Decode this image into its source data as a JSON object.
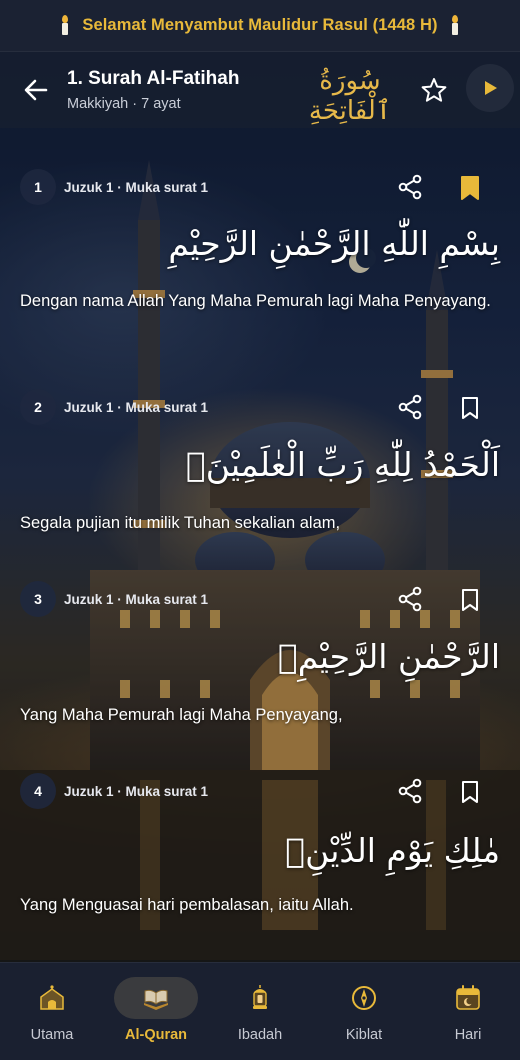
{
  "banner": {
    "text": "Selamat Menyambut Maulidur Rasul (1448 H)"
  },
  "header": {
    "title": "1. Surah Al-Fatihah",
    "subtitle": "Makkiyah · 7 ayat",
    "arabic_title": "سُورَةُ ٱلْفَاتِحَةِ"
  },
  "verses": [
    {
      "number": "1",
      "meta": "Juzuk 1 · Muka surat 1",
      "arabic": "بِسْمِ اللّٰهِ الرَّحْمٰنِ الرَّحِيْمِ",
      "translation": "Dengan nama Allah Yang Maha Pemurah lagi Maha Penyayang.",
      "bookmarked": true
    },
    {
      "number": "2",
      "meta": "Juzuk 1 · Muka surat 1",
      "arabic": "اَلْحَمْدُ لِلّٰهِ رَبِّ الْعٰلَمِيْنَۙ",
      "translation": "Segala pujian itu milik Tuhan sekalian alam,",
      "bookmarked": false
    },
    {
      "number": "3",
      "meta": "Juzuk 1 · Muka surat 1",
      "arabic": "الرَّحْمٰنِ الرَّحِيْمِۙ",
      "translation": "Yang Maha Pemurah lagi Maha Penyayang,",
      "bookmarked": false
    },
    {
      "number": "4",
      "meta": "Juzuk 1 · Muka surat 1",
      "arabic": "مٰلِكِ يَوْمِ الدِّيْنِۗ",
      "translation": "Yang Menguasai hari pembalasan, iaitu Allah.",
      "bookmarked": false
    }
  ],
  "nav": {
    "items": [
      {
        "label": "Utama",
        "icon": "mosque-home-icon",
        "active": false
      },
      {
        "label": "Al-Quran",
        "icon": "quran-icon",
        "active": true
      },
      {
        "label": "Ibadah",
        "icon": "lantern-icon",
        "active": false
      },
      {
        "label": "Kiblat",
        "icon": "compass-icon",
        "active": false
      },
      {
        "label": "Hari",
        "icon": "calendar-icon",
        "active": false
      }
    ]
  },
  "colors": {
    "accent": "#e8b93a",
    "banner_bg": "#1b2233",
    "nav_bg": "#1a2030",
    "pill_bg": "#3a3b3e"
  }
}
